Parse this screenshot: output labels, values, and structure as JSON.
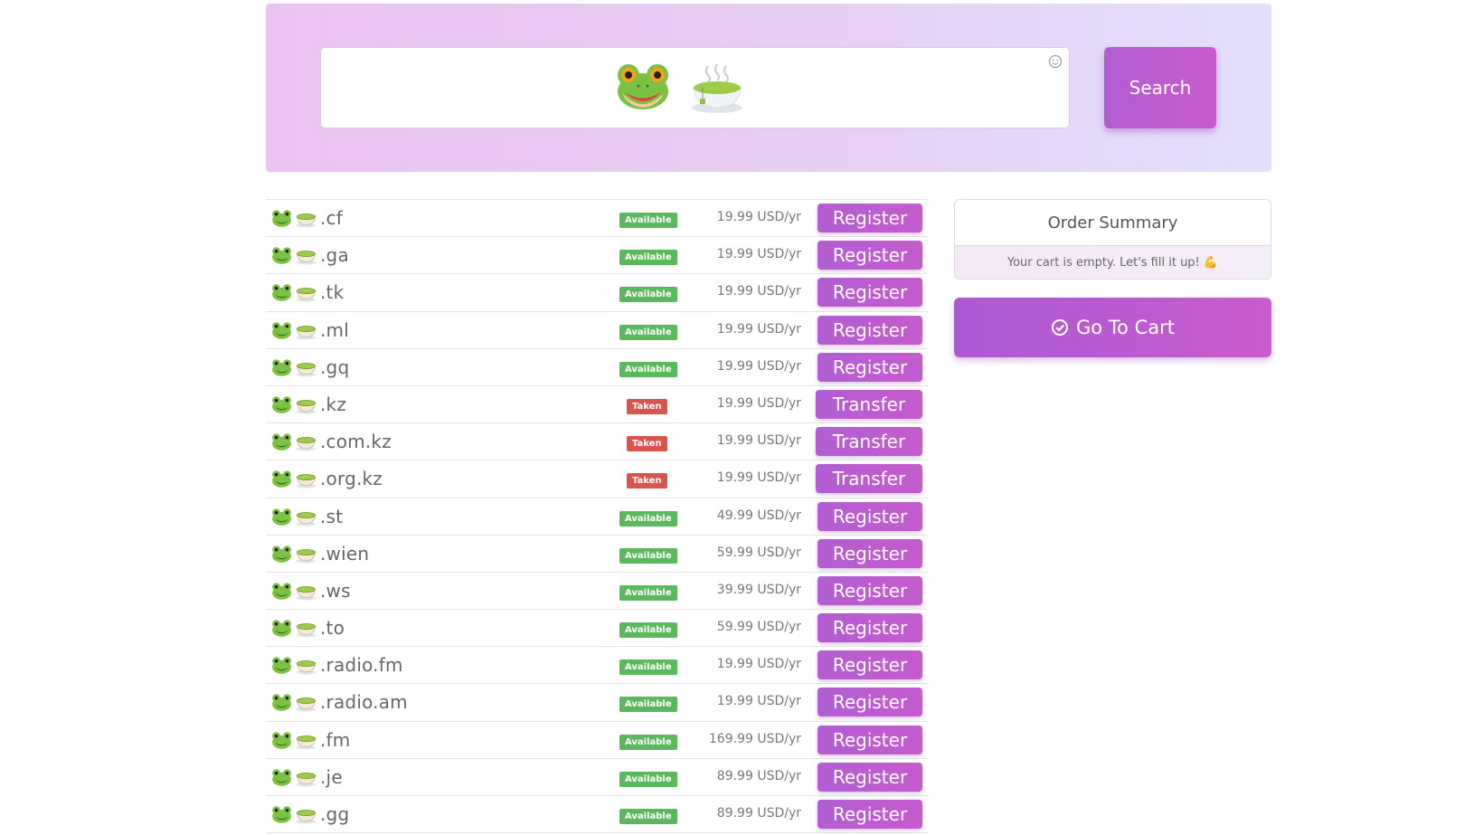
{
  "search": {
    "query_emojis": [
      "frog-face",
      "tea-cup"
    ],
    "button_label": "Search"
  },
  "results": [
    {
      "tld": ".cf",
      "status": "Available",
      "price": "19.99 USD/yr",
      "action": "Register"
    },
    {
      "tld": ".ga",
      "status": "Available",
      "price": "19.99 USD/yr",
      "action": "Register"
    },
    {
      "tld": ".tk",
      "status": "Available",
      "price": "19.99 USD/yr",
      "action": "Register"
    },
    {
      "tld": ".ml",
      "status": "Available",
      "price": "19.99 USD/yr",
      "action": "Register"
    },
    {
      "tld": ".gq",
      "status": "Available",
      "price": "19.99 USD/yr",
      "action": "Register"
    },
    {
      "tld": ".kz",
      "status": "Taken",
      "price": "19.99 USD/yr",
      "action": "Transfer"
    },
    {
      "tld": ".com.kz",
      "status": "Taken",
      "price": "19.99 USD/yr",
      "action": "Transfer"
    },
    {
      "tld": ".org.kz",
      "status": "Taken",
      "price": "19.99 USD/yr",
      "action": "Transfer"
    },
    {
      "tld": ".st",
      "status": "Available",
      "price": "49.99 USD/yr",
      "action": "Register"
    },
    {
      "tld": ".wien",
      "status": "Available",
      "price": "59.99 USD/yr",
      "action": "Register"
    },
    {
      "tld": ".ws",
      "status": "Available",
      "price": "39.99 USD/yr",
      "action": "Register"
    },
    {
      "tld": ".to",
      "status": "Available",
      "price": "59.99 USD/yr",
      "action": "Register"
    },
    {
      "tld": ".radio.fm",
      "status": "Available",
      "price": "19.99 USD/yr",
      "action": "Register"
    },
    {
      "tld": ".radio.am",
      "status": "Available",
      "price": "19.99 USD/yr",
      "action": "Register"
    },
    {
      "tld": ".fm",
      "status": "Available",
      "price": "169.99 USD/yr",
      "action": "Register"
    },
    {
      "tld": ".je",
      "status": "Available",
      "price": "89.99 USD/yr",
      "action": "Register"
    },
    {
      "tld": ".gg",
      "status": "Available",
      "price": "89.99 USD/yr",
      "action": "Register"
    }
  ],
  "order_summary": {
    "title": "Order Summary",
    "empty_message": "Your cart is empty. Let's fill it up! 💪"
  },
  "cart": {
    "button_label": "Go To Cart"
  },
  "colors": {
    "accent": "#b95cd0",
    "available": "#5cb85c",
    "taken": "#d9534f"
  }
}
